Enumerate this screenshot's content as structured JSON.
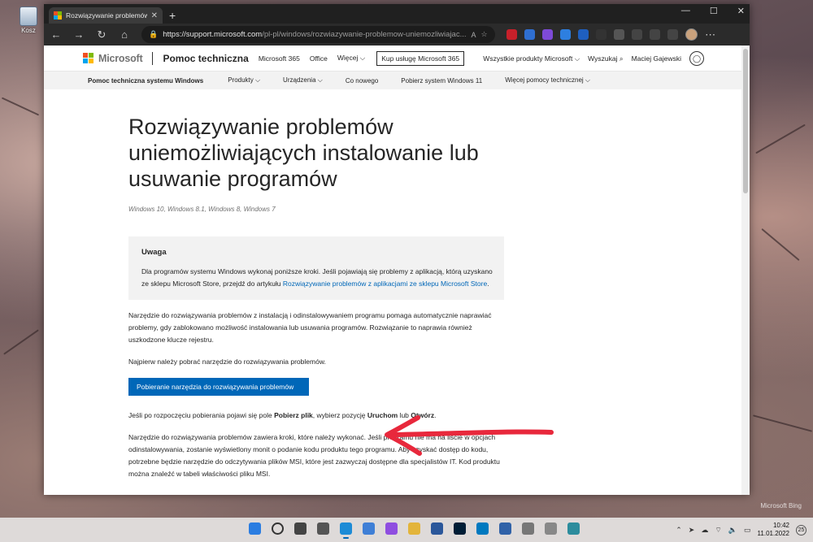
{
  "desktop": {
    "recycle_bin_label": "Kosz",
    "watermark": "Microsoft Bing"
  },
  "browser": {
    "tab_title": "Rozwiązywanie problemów uniem",
    "url_host": "https://support.microsoft.com",
    "url_path": "/pl-pl/windows/rozwiazywanie-problemow-uniemozliwiajac...",
    "window_controls": [
      "—",
      "☐",
      "✕"
    ]
  },
  "header": {
    "brand": "Microsoft",
    "section": "Pomoc techniczna",
    "nav": [
      "Microsoft 365",
      "Office",
      "Więcej ⌵"
    ],
    "buy_button": "Kup usługę Microsoft 365",
    "all_products": "Wszystkie produkty Microsoft ⌵",
    "search": "Wyszukaj",
    "user": "Maciej Gajewski"
  },
  "subnav": [
    "Pomoc techniczna systemu Windows",
    "Produkty ⌵",
    "Urządzenia ⌵",
    "Co nowego",
    "Pobierz system Windows 11",
    "Więcej pomocy technicznej ⌵"
  ],
  "article": {
    "title": "Rozwiązywanie problemów uniemożliwiających instalowanie lub usuwanie programów",
    "applies_to": "Windows 10, Windows 8.1, Windows 8, Windows 7",
    "note_title": "Uwaga",
    "note_text": "Dla programów systemu Windows wykonaj poniższe kroki. Jeśli pojawiają się problemy z aplikacją, którą uzyskano ze sklepu Microsoft Store, przejdź do artykułu ",
    "note_link": "Rozwiązywanie problemów z aplikacjami ze sklepu Microsoft Store",
    "note_end": ".",
    "para1": "Narzędzie do rozwiązywania problemów z instalacją i odinstalowywaniem programu pomaga automatycznie naprawiać problemy, gdy zablokowano możliwość instalowania lub usuwania programów. Rozwiązanie to naprawia również uszkodzone klucze rejestru.",
    "para2": "Najpierw należy pobrać narzędzie do rozwiązywania problemów.",
    "download_button": "Pobieranie narzędzia do rozwiązywania problemów",
    "para3_a": "Jeśli po rozpoczęciu pobierania pojawi się pole ",
    "para3_b": "Pobierz plik",
    "para3_c": ", wybierz pozycję ",
    "para3_d": "Uruchom",
    "para3_e": " lub ",
    "para3_f": "Otwórz",
    "para3_g": ".",
    "para4": "Narzędzie do rozwiązywania problemów zawiera kroki, które należy wykonać. Jeśli programu nie ma na liście w opcjach odinstalowywania, zostanie wyświetlony monit o podanie kodu produktu tego programu. Aby uzyskać dostęp do kodu, potrzebne będzie narzędzie do odczytywania plików MSI, które jest zazwyczaj dostępne dla specjalistów IT. Kod produktu można znaleźć w tabeli właściwości pliku MSI."
  },
  "taskbar": {
    "time": "10:42",
    "date": "11.01.2022",
    "notifications": "25"
  },
  "colors": {
    "accent": "#0067b8",
    "arrow": "#e8283c"
  }
}
